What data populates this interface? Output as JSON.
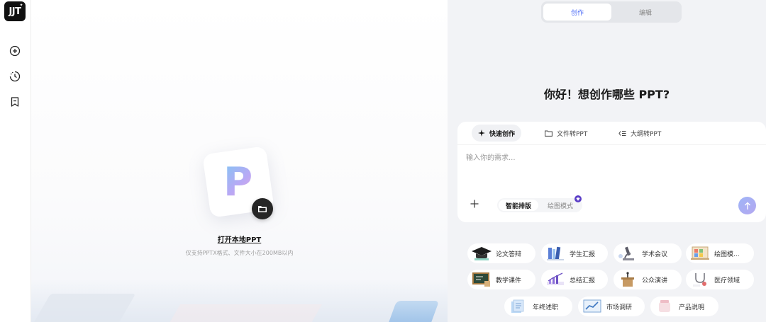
{
  "brand": {
    "logo_text": "JJT"
  },
  "rail": {
    "items": [
      "new-icon",
      "history-icon",
      "bookmark-icon"
    ]
  },
  "upload": {
    "open_local": "打开本地PPT",
    "note": "仅支持PPTX格式、文件大小在200MB以内"
  },
  "mode": {
    "tabs": [
      "创作",
      "编辑"
    ],
    "active": "创作"
  },
  "greeting": "你好！想创作哪些 PPT?",
  "create": {
    "tabs": [
      {
        "label": "快速创作",
        "icon": "sparkle-icon"
      },
      {
        "label": "文件转PPT",
        "icon": "folder-icon"
      },
      {
        "label": "大纲转PPT",
        "icon": "outline-icon"
      }
    ],
    "placeholder": "输入你的需求...",
    "layout_options": [
      "智能排版",
      "绘图模式"
    ],
    "colors": {
      "accent": "#4f6ef7",
      "vip": "#5b3ec7"
    }
  },
  "categories": [
    "论文答辩",
    "学生汇报",
    "学术会议",
    "绘图模...",
    "教学课件",
    "总结汇报",
    "公众演讲",
    "医疗领域",
    "年终述职",
    "市场调研",
    "产品说明"
  ]
}
